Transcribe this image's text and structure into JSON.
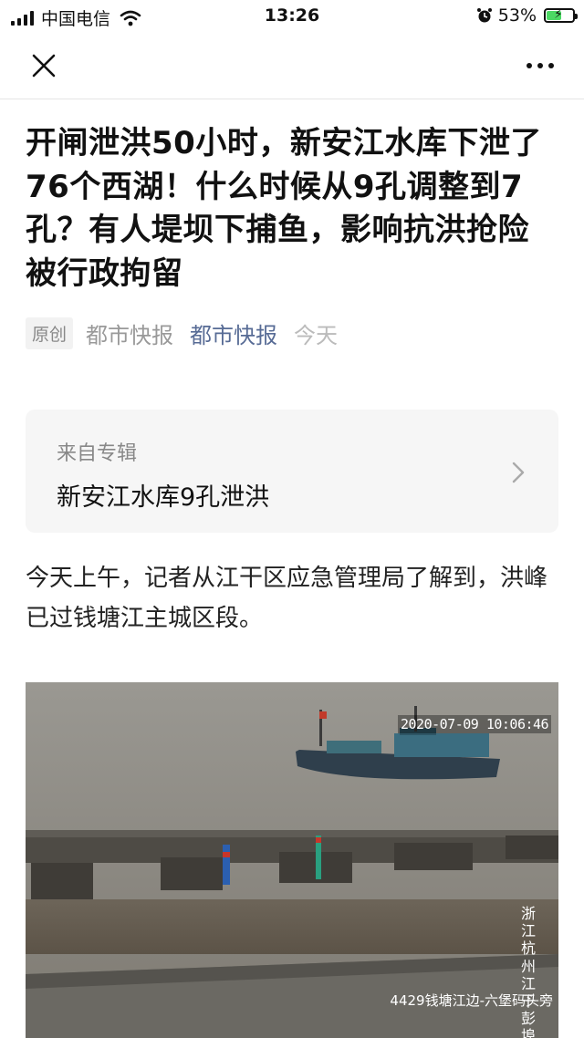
{
  "status_bar": {
    "carrier": "中国电信",
    "time": "13:26",
    "battery": "53%"
  },
  "nav": {
    "close_icon": "close-icon",
    "more_icon": "more-icon"
  },
  "article": {
    "title": "开闸泄洪50小时，新安江水库下泄了76个西湖！什么时候从9孔调整到7孔？有人堤坝下捕鱼，影响抗洪抢险被行政拘留",
    "badge": "原创",
    "author": "都市快报",
    "account": "都市快报",
    "date": "今天"
  },
  "collection": {
    "label": "来自专辑",
    "name": "新安江水库9孔泄洪"
  },
  "paragraph": "今天上午，记者从江干区应急管理局了解到，洪峰已过钱塘江主城区段。",
  "photo": {
    "timestamp": "2020-07-09  10:06:46",
    "location": "浙江杭州江干彭埠",
    "camera": "4429钱塘江边-六堡码头旁"
  }
}
